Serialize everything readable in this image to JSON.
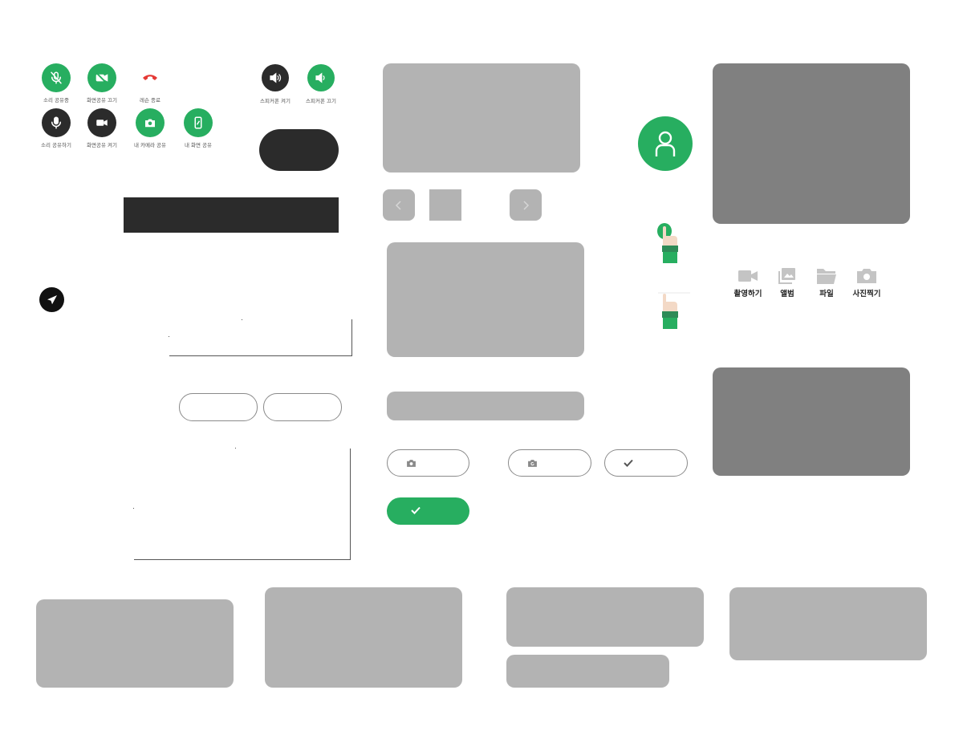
{
  "controls": {
    "mic_sharing_label": "소리 공유중",
    "screen_share_off_label": "화면공유 끄기",
    "end_lesson_label": "레슨 종료",
    "mic_share_label": "소리 공유하기",
    "screen_share_on_label": "화면공유 켜기",
    "my_camera_share_label": "내 카메라 공유",
    "my_screen_share_label": "내 화면 공유",
    "speaker_on_label": "스피커폰 켜기",
    "speaker_off_label": "스피커폰 끄기"
  },
  "attach_menu": {
    "items": [
      {
        "label": "촬영하기",
        "icon": "video-camera-icon"
      },
      {
        "label": "앨범",
        "icon": "album-icon"
      },
      {
        "label": "파일",
        "icon": "folder-icon"
      },
      {
        "label": "사진찍기",
        "icon": "camera-icon"
      }
    ]
  },
  "colors": {
    "accent_green": "#27ae60",
    "dark": "#2b2b2b",
    "end_call_red": "#e53935",
    "placeholder_light": "#b3b3b3",
    "placeholder_dark": "#808080"
  }
}
